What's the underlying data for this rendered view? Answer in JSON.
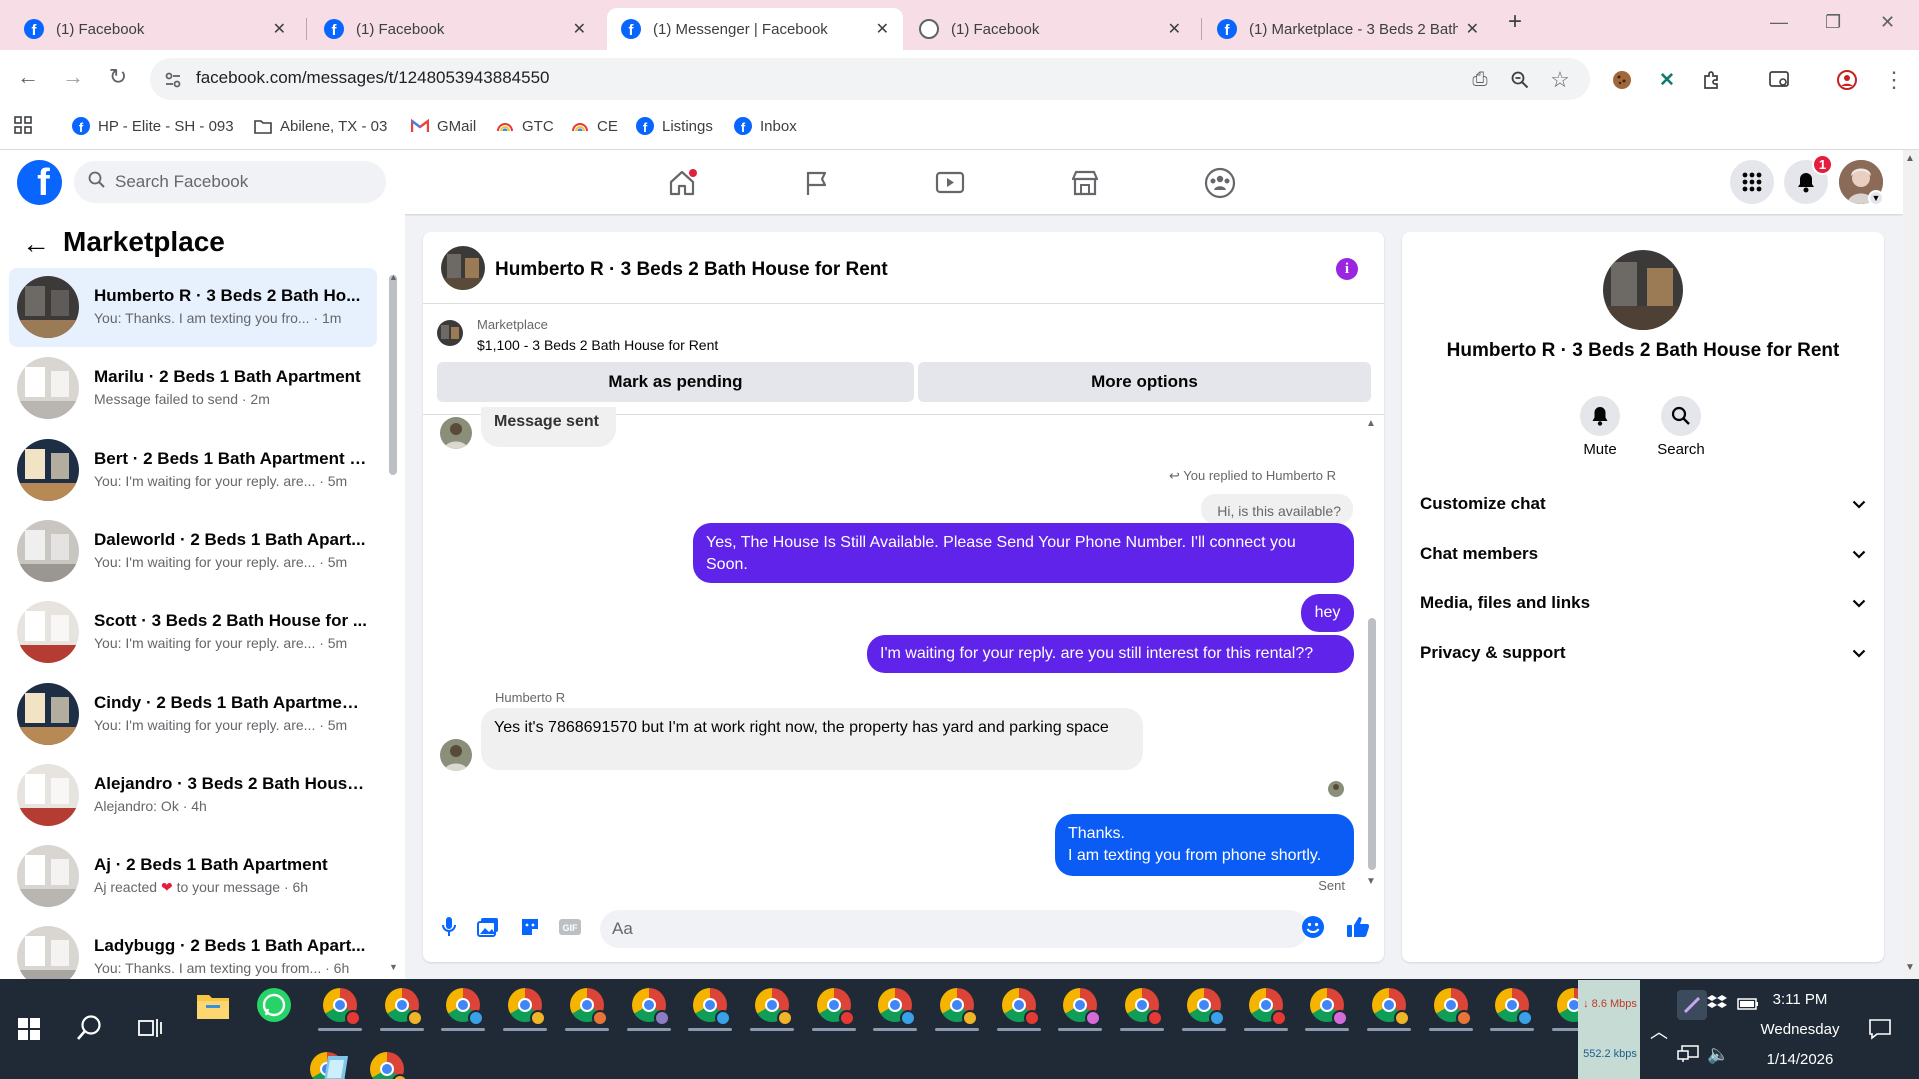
{
  "browser": {
    "tabs": [
      {
        "title": "(1) Facebook",
        "active": false
      },
      {
        "title": "(1) Facebook",
        "active": false
      },
      {
        "title": "(1) Messenger | Facebook",
        "active": true
      },
      {
        "title": "(1) Facebook",
        "active": false
      },
      {
        "title": "(1) Marketplace - 3 Beds 2 Bath",
        "active": false
      }
    ],
    "url": "facebook.com/messages/t/1248053943884550",
    "bookmarks": [
      {
        "label": "HP - Elite - SH - 093",
        "icon": "facebook-icon"
      },
      {
        "label": "Abilene, TX - 03",
        "icon": "folder-icon"
      },
      {
        "label": "GMail",
        "icon": "gmail-icon"
      },
      {
        "label": "GTC",
        "icon": "rainbow-icon"
      },
      {
        "label": "CE",
        "icon": "rainbow-icon"
      },
      {
        "label": "Listings",
        "icon": "facebook-icon"
      },
      {
        "label": "Inbox",
        "icon": "facebook-icon"
      }
    ]
  },
  "header": {
    "search_placeholder": "Search Facebook",
    "notification_count": "1"
  },
  "sidebar": {
    "title": "Marketplace",
    "conversations": [
      {
        "name": "Humberto R · 3 Beds 2 Bath Ho...",
        "preview": "You: Thanks. I am texting you fro...",
        "time": "· 1m",
        "active": true
      },
      {
        "name": "Marilu · 2 Beds 1 Bath Apartment",
        "preview": "Message failed to send",
        "time": "· 2m",
        "active": false
      },
      {
        "name": "Bert · 2 Beds 1 Bath Apartment f...",
        "preview": "You: I'm waiting for your reply. are...",
        "time": "· 5m",
        "active": false
      },
      {
        "name": "Daleworld · 2 Beds 1 Bath Apart...",
        "preview": "You: I'm waiting for your reply. are...",
        "time": "· 5m",
        "active": false
      },
      {
        "name": "Scott · 3 Beds 2 Bath House for ...",
        "preview": "You: I'm waiting for your reply. are...",
        "time": "· 5m",
        "active": false
      },
      {
        "name": "Cindy · 2 Beds 1 Bath Apartment...",
        "preview": "You: I'm waiting for your reply. are...",
        "time": "· 5m",
        "active": false
      },
      {
        "name": "Alejandro · 3 Beds 2 Bath House...",
        "preview": "Alejandro: Ok",
        "time": "· 4h",
        "active": false
      },
      {
        "name": "Aj · 2 Beds 1 Bath Apartment",
        "preview": "Aj reacted",
        "preview_suffix": "to your message",
        "time": "· 6h",
        "active": false
      },
      {
        "name": "Ladybugg · 2 Beds 1 Bath Apart...",
        "preview": "You: Thanks. I am texting you from...",
        "time": "· 6h",
        "active": false
      }
    ]
  },
  "chat": {
    "title": "Humberto R · 3 Beds 2 Bath House for Rent",
    "marketplace_label": "Marketplace",
    "listing": "$1,100 - 3 Beds 2 Bath House for Rent",
    "mark_pending": "Mark as pending",
    "more_options": "More options",
    "messages": {
      "m0": "Message sent",
      "reply_note": "You replied to Humberto R",
      "quoted": "Hi, is this available?",
      "m1": "Yes, The House Is Still Available. Please Send Your Phone Number. I'll connect you Soon.",
      "m2": "hey",
      "m3": "I'm waiting for your reply. are you still interest for this rental??",
      "sender": "Humberto R",
      "m4": "Yes it's 7868691570 but I'm at work right now, the property has yard and parking space",
      "m5": "Thanks.\nI am texting you from phone shortly.",
      "status": "Sent"
    },
    "composer_placeholder": "Aa"
  },
  "details": {
    "title": "Humberto R · 3 Beds 2 Bath House for Rent",
    "mute": "Mute",
    "search": "Search",
    "sections": [
      "Customize chat",
      "Chat members",
      "Media, files and links",
      "Privacy & support"
    ]
  },
  "taskbar": {
    "net_down": "↓ 8.6 Mbps",
    "net_up": "552.2 kbps",
    "time": "3:11 PM",
    "day": "Wednesday",
    "date": "1/14/2026"
  },
  "colors": {
    "facebook_blue": "#0866ff",
    "outgoing_bubble": "#6023ea",
    "incoming_bubble": "#f0f0f0",
    "active_row": "#e7f0fd"
  }
}
